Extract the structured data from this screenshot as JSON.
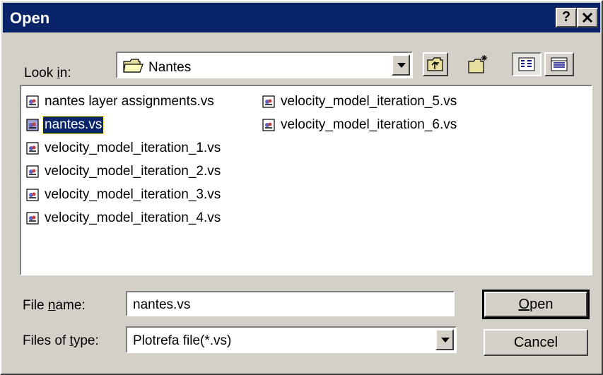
{
  "window": {
    "title": "Open",
    "help_label": "?",
    "close_label": "✕"
  },
  "look_in": {
    "label_pre": "Look ",
    "label_ul": "i",
    "label_post": "n:",
    "folder": "Nantes",
    "folder_icon": "folder-icon"
  },
  "toolbar": {
    "up_icon": "up-one-level-icon",
    "new_folder_icon": "create-new-folder-icon",
    "list_icon": "list-view-icon",
    "details_icon": "details-view-icon"
  },
  "files": [
    {
      "name": "nantes layer assignments.vs",
      "selected": false
    },
    {
      "name": "nantes.vs",
      "selected": true
    },
    {
      "name": "velocity_model_iteration_1.vs",
      "selected": false
    },
    {
      "name": "velocity_model_iteration_2.vs",
      "selected": false
    },
    {
      "name": "velocity_model_iteration_3.vs",
      "selected": false
    },
    {
      "name": "velocity_model_iteration_4.vs",
      "selected": false
    },
    {
      "name": "velocity_model_iteration_5.vs",
      "selected": false
    },
    {
      "name": "velocity_model_iteration_6.vs",
      "selected": false
    }
  ],
  "file_name": {
    "label_pre": "File ",
    "label_ul": "n",
    "label_post": "ame:",
    "value": "nantes.vs"
  },
  "file_type": {
    "label_pre": "Files of ",
    "label_ul": "t",
    "label_post": "ype:",
    "value": "Plotrefa file(*.vs)"
  },
  "buttons": {
    "open_ul": "O",
    "open_rest": "pen",
    "cancel": "Cancel"
  },
  "colors": {
    "title_bar": "#0a246a",
    "face": "#d4d0c8",
    "selection": "#0a246a"
  }
}
